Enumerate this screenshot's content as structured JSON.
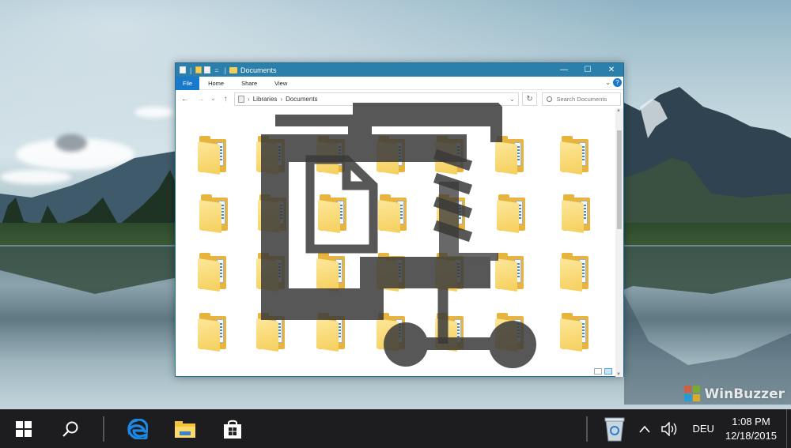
{
  "window": {
    "title": "Documents",
    "controls": {
      "minimize": "—",
      "maximize": "☐",
      "close": "✕"
    }
  },
  "ribbon": {
    "tabs": [
      "File",
      "Home",
      "Share",
      "View"
    ],
    "help": "?"
  },
  "address": {
    "path": [
      "Libraries",
      "Documents"
    ],
    "search_placeholder": "Search Documents"
  },
  "folders_count_note": "28 folder icons, unlabeled",
  "taskbar": {
    "apps": [
      "start-icon",
      "search-icon",
      "edge-icon",
      "file-explorer-icon",
      "store-icon"
    ],
    "tray": {
      "language": "DEU",
      "time": "1:08 PM",
      "date": "12/18/2015"
    }
  },
  "watermark": "WinBuzzer",
  "colors": {
    "titlebar": "#2b7fab",
    "file_tab": "#1979ca",
    "taskbar": "#1d1d1f",
    "folder": "#f5cf5c",
    "zip_overlay": "#3a3a3a"
  }
}
